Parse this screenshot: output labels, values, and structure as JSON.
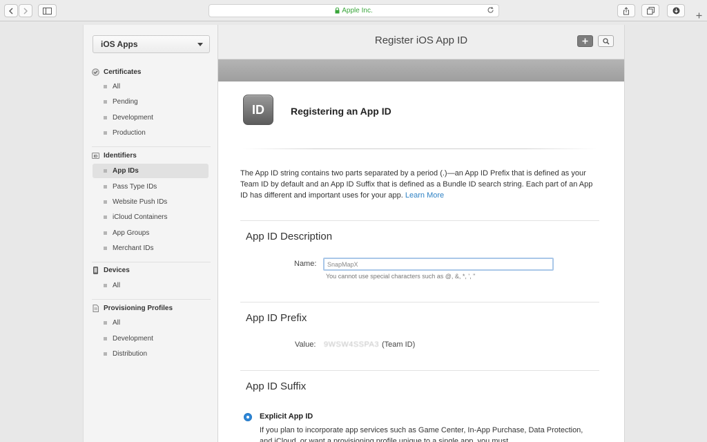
{
  "browser": {
    "url_text": "Apple Inc."
  },
  "sidebar": {
    "app_selector": "iOS Apps",
    "sections": [
      {
        "title": "Certificates",
        "icon": "certificate-icon",
        "items": [
          "All",
          "Pending",
          "Development",
          "Production"
        ]
      },
      {
        "title": "Identifiers",
        "icon": "id-badge-icon",
        "items": [
          "App IDs",
          "Pass Type IDs",
          "Website Push IDs",
          "iCloud Containers",
          "App Groups",
          "Merchant IDs"
        ]
      },
      {
        "title": "Devices",
        "icon": "device-icon",
        "items": [
          "All"
        ]
      },
      {
        "title": "Provisioning Profiles",
        "icon": "document-icon",
        "items": [
          "All",
          "Development",
          "Distribution"
        ]
      }
    ],
    "active_item": "App IDs"
  },
  "main": {
    "title": "Register iOS App ID",
    "icon_text": "ID",
    "registering_title": "Registering an App ID",
    "intro": "The App ID string contains two parts separated by a period (.)—an App ID Prefix that is defined as your Team ID by default and an App ID Suffix that is defined as a Bundle ID search string. Each part of an App ID has different and important uses for your app.",
    "learn_more": "Learn More",
    "description_section": {
      "title": "App ID Description",
      "name_label": "Name:",
      "name_value": "SnapMapX",
      "hint": "You cannot use special characters such as @, &, *, ', \""
    },
    "prefix_section": {
      "title": "App ID Prefix",
      "value_label": "Value:",
      "team_id": "9WSW4SSPA3",
      "team_id_suffix": "(Team ID)"
    },
    "suffix_section": {
      "title": "App ID Suffix",
      "explicit_label": "Explicit App ID",
      "explicit_desc": "If you plan to incorporate app services such as Game Center, In-App Purchase, Data Protection, and iCloud, or want a provisioning profile unique to a single app, you must"
    }
  },
  "colors": {
    "accent": "#2e86d6",
    "link": "#2d81c4",
    "secure": "#38a53a"
  }
}
